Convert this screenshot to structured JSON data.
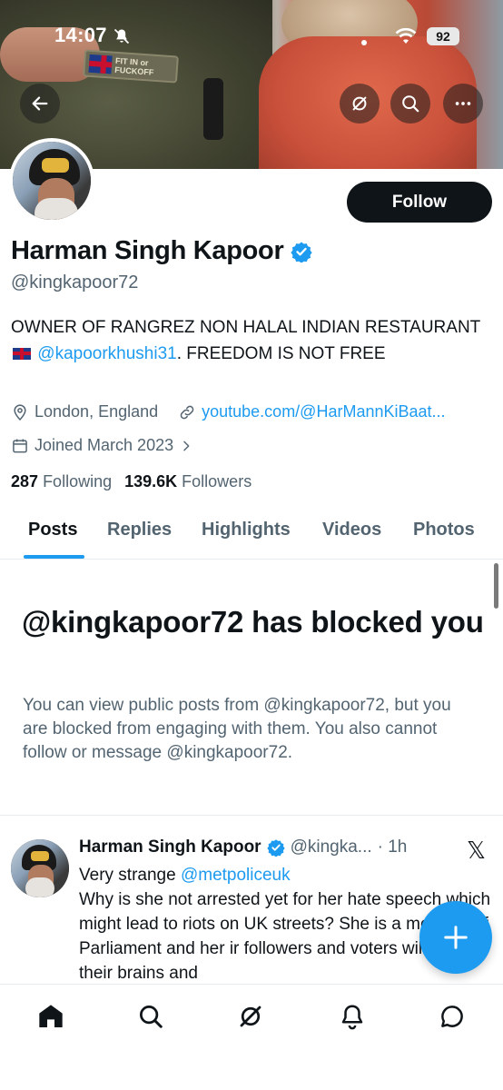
{
  "status_bar": {
    "time": "14:07",
    "battery": "92"
  },
  "banner": {
    "patch_text": "FIT IN or FUCKOFF"
  },
  "header_actions": {
    "back": "arrow-left-icon",
    "grok": "grok-icon",
    "search": "search-icon",
    "more": "more-icon"
  },
  "profile": {
    "follow_label": "Follow",
    "name": "Harman Singh Kapoor",
    "handle": "@kingkapoor72",
    "bio_part1": "OWNER OF RANGREZ NON HALAL INDIAN RESTAURANT ",
    "bio_mention": "@kapoorkhushi31",
    "bio_part2": ". FREEDOM IS NOT FREE",
    "location": "London, England",
    "website": "youtube.com/@HarMannKiBaat...",
    "joined": "Joined March 2023",
    "following_count": "287",
    "following_label": "Following",
    "followers_count": "139.6K",
    "followers_label": "Followers"
  },
  "tabs": [
    "Posts",
    "Replies",
    "Highlights",
    "Videos",
    "Photos"
  ],
  "blocked": {
    "title": "@kingkapoor72 has blocked you",
    "text": "You can view public posts from @kingkapoor72, but you are blocked from engaging with them. You also cannot follow or message @kingkapoor72."
  },
  "post": {
    "name": "Harman Singh Kapoor",
    "handle": "@kingka...",
    "time": "· 1h",
    "line1_prefix": "Very strange ",
    "line1_mention": "@metpoliceuk",
    "body": "Why is she not arrested yet for her hate speech which might lead to riots on UK streets? She is a member of Parliament and her ir followers and voters will not use their brains and",
    "x_logo": "𝕏"
  },
  "bottom_nav": [
    "home-icon",
    "search-icon",
    "grok-icon",
    "notifications-icon",
    "messages-icon"
  ],
  "colors": {
    "accent": "#1d9bf0",
    "text": "#0f1419",
    "secondary": "#536471"
  }
}
